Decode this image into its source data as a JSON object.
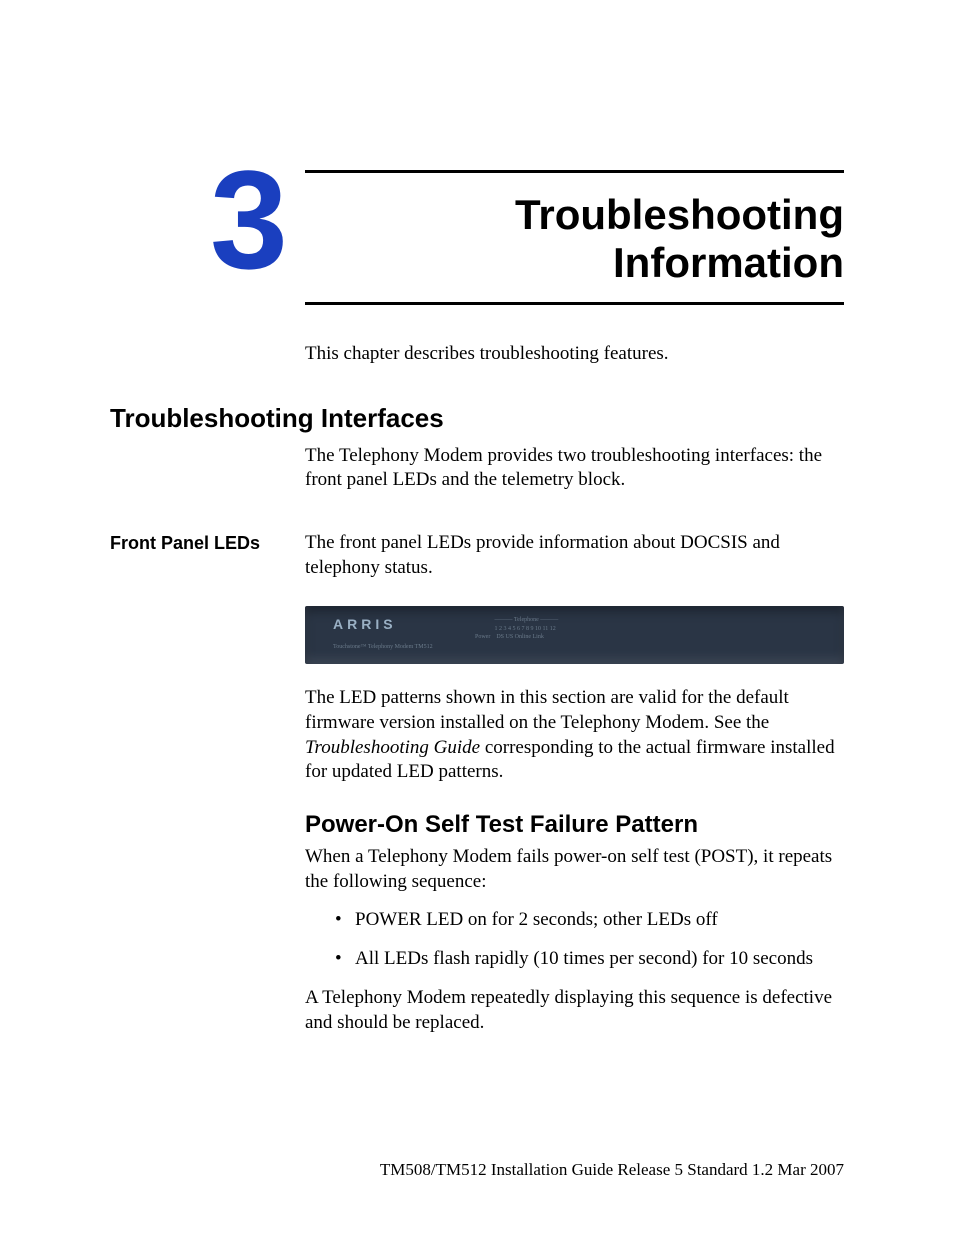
{
  "chapter": {
    "number": "3",
    "title_line1": "Troubleshooting",
    "title_line2": "Information",
    "intro": "This chapter describes troubleshooting features."
  },
  "section1": {
    "heading": "Troubleshooting Interfaces",
    "body": "The Telephony Modem provides two troubleshooting interfaces: the front panel LEDs and the telemetry block."
  },
  "subsection1": {
    "label": "Front Panel LEDs",
    "intro": "The front panel LEDs provide information about DOCSIS and telephony status.",
    "modem": {
      "brand": "ARRIS",
      "model": "Touchstone™ Telephony Modem TM512"
    },
    "para2_part1": "The LED patterns shown in this section are valid for the default firmware version installed on the Telephony Modem. See the ",
    "para2_italic": "Troubleshooting Guide",
    "para2_part2": " corresponding to the actual firmware installed for updated LED patterns."
  },
  "section2": {
    "heading": "Power-On Self Test Failure Pattern",
    "intro": "When a Telephony Modem fails power-on self test (POST), it repeats the following sequence:",
    "bullets": [
      "POWER LED on for 2 seconds; other LEDs off",
      "All LEDs flash rapidly (10 times per second) for 10 seconds"
    ],
    "outro": "A Telephony Modem repeatedly displaying this sequence is defective and should be replaced."
  },
  "footer": "TM508/TM512 Installation Guide   Release 5   Standard 1.2   Mar 2007"
}
